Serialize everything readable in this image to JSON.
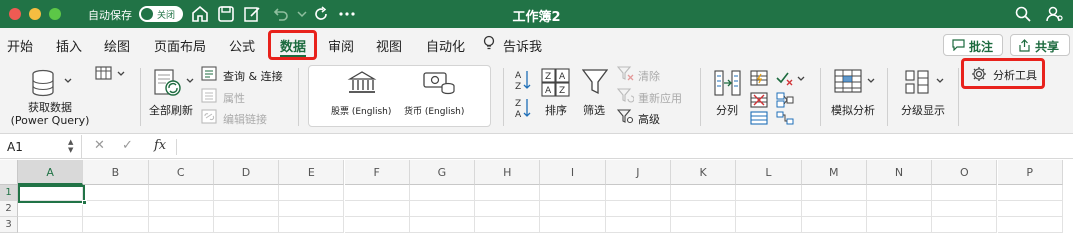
{
  "titlebar": {
    "autosave_label": "自动保存",
    "toggle_state": "关闭",
    "workbook_title": "工作簿2",
    "bg_color": "#217346"
  },
  "tabs": [
    {
      "label": "开始"
    },
    {
      "label": "插入"
    },
    {
      "label": "绘图"
    },
    {
      "label": "页面布局"
    },
    {
      "label": "公式"
    },
    {
      "label": "数据",
      "active": true
    },
    {
      "label": "审阅"
    },
    {
      "label": "视图"
    },
    {
      "label": "自动化"
    },
    {
      "label": "告诉我"
    }
  ],
  "actions": {
    "comment_label": "批注",
    "share_label": "共享"
  },
  "ribbon": {
    "get_data_label": "获取数据 (Power Query)",
    "refresh_all_label": "全部刷新",
    "queries_connections_label": "查询 & 连接",
    "properties_label": "属性",
    "edit_links_label": "编辑链接",
    "stocks_label": "股票 (English)",
    "currencies_label": "货币 (English)",
    "sort_label": "排序",
    "filter_label": "筛选",
    "clear_label": "清除",
    "reapply_label": "重新应用",
    "advanced_label": "高级",
    "text_to_columns_label": "分列",
    "what_if_label": "模拟分析",
    "outline_label": "分级显示",
    "analysis_tools_label": "分析工具"
  },
  "formula_bar": {
    "name_box_value": "A1",
    "fx_label": "fx",
    "formula_value": ""
  },
  "grid": {
    "columns": [
      "A",
      "B",
      "C",
      "D",
      "E",
      "F",
      "G",
      "H",
      "I",
      "J",
      "K",
      "L",
      "M",
      "N",
      "O",
      "P"
    ],
    "rows": [
      "1",
      "2",
      "3"
    ],
    "selected_cell": "A1"
  },
  "colors": {
    "accent": "#217346",
    "highlight": "#e8221c"
  }
}
